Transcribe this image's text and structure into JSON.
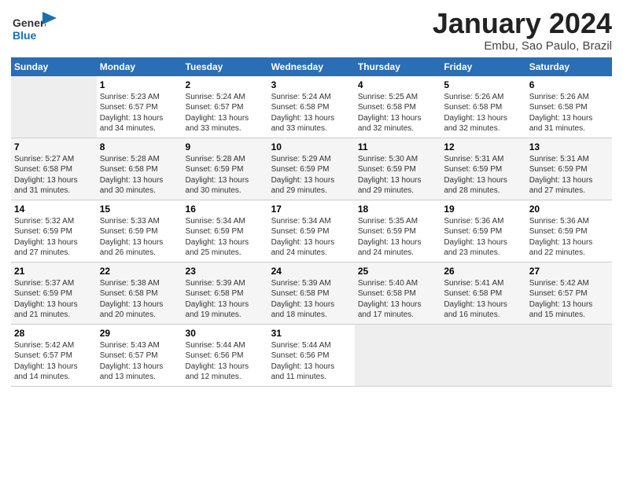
{
  "logo": {
    "general": "General",
    "blue": "Blue"
  },
  "title": {
    "month": "January 2024",
    "location": "Embu, Sao Paulo, Brazil"
  },
  "days_header": [
    "Sunday",
    "Monday",
    "Tuesday",
    "Wednesday",
    "Thursday",
    "Friday",
    "Saturday"
  ],
  "weeks": [
    [
      {
        "num": "",
        "info": ""
      },
      {
        "num": "1",
        "info": "Sunrise: 5:23 AM\nSunset: 6:57 PM\nDaylight: 13 hours\nand 34 minutes."
      },
      {
        "num": "2",
        "info": "Sunrise: 5:24 AM\nSunset: 6:57 PM\nDaylight: 13 hours\nand 33 minutes."
      },
      {
        "num": "3",
        "info": "Sunrise: 5:24 AM\nSunset: 6:58 PM\nDaylight: 13 hours\nand 33 minutes."
      },
      {
        "num": "4",
        "info": "Sunrise: 5:25 AM\nSunset: 6:58 PM\nDaylight: 13 hours\nand 32 minutes."
      },
      {
        "num": "5",
        "info": "Sunrise: 5:26 AM\nSunset: 6:58 PM\nDaylight: 13 hours\nand 32 minutes."
      },
      {
        "num": "6",
        "info": "Sunrise: 5:26 AM\nSunset: 6:58 PM\nDaylight: 13 hours\nand 31 minutes."
      }
    ],
    [
      {
        "num": "7",
        "info": "Sunrise: 5:27 AM\nSunset: 6:58 PM\nDaylight: 13 hours\nand 31 minutes."
      },
      {
        "num": "8",
        "info": "Sunrise: 5:28 AM\nSunset: 6:58 PM\nDaylight: 13 hours\nand 30 minutes."
      },
      {
        "num": "9",
        "info": "Sunrise: 5:28 AM\nSunset: 6:59 PM\nDaylight: 13 hours\nand 30 minutes."
      },
      {
        "num": "10",
        "info": "Sunrise: 5:29 AM\nSunset: 6:59 PM\nDaylight: 13 hours\nand 29 minutes."
      },
      {
        "num": "11",
        "info": "Sunrise: 5:30 AM\nSunset: 6:59 PM\nDaylight: 13 hours\nand 29 minutes."
      },
      {
        "num": "12",
        "info": "Sunrise: 5:31 AM\nSunset: 6:59 PM\nDaylight: 13 hours\nand 28 minutes."
      },
      {
        "num": "13",
        "info": "Sunrise: 5:31 AM\nSunset: 6:59 PM\nDaylight: 13 hours\nand 27 minutes."
      }
    ],
    [
      {
        "num": "14",
        "info": "Sunrise: 5:32 AM\nSunset: 6:59 PM\nDaylight: 13 hours\nand 27 minutes."
      },
      {
        "num": "15",
        "info": "Sunrise: 5:33 AM\nSunset: 6:59 PM\nDaylight: 13 hours\nand 26 minutes."
      },
      {
        "num": "16",
        "info": "Sunrise: 5:34 AM\nSunset: 6:59 PM\nDaylight: 13 hours\nand 25 minutes."
      },
      {
        "num": "17",
        "info": "Sunrise: 5:34 AM\nSunset: 6:59 PM\nDaylight: 13 hours\nand 24 minutes."
      },
      {
        "num": "18",
        "info": "Sunrise: 5:35 AM\nSunset: 6:59 PM\nDaylight: 13 hours\nand 24 minutes."
      },
      {
        "num": "19",
        "info": "Sunrise: 5:36 AM\nSunset: 6:59 PM\nDaylight: 13 hours\nand 23 minutes."
      },
      {
        "num": "20",
        "info": "Sunrise: 5:36 AM\nSunset: 6:59 PM\nDaylight: 13 hours\nand 22 minutes."
      }
    ],
    [
      {
        "num": "21",
        "info": "Sunrise: 5:37 AM\nSunset: 6:59 PM\nDaylight: 13 hours\nand 21 minutes."
      },
      {
        "num": "22",
        "info": "Sunrise: 5:38 AM\nSunset: 6:58 PM\nDaylight: 13 hours\nand 20 minutes."
      },
      {
        "num": "23",
        "info": "Sunrise: 5:39 AM\nSunset: 6:58 PM\nDaylight: 13 hours\nand 19 minutes."
      },
      {
        "num": "24",
        "info": "Sunrise: 5:39 AM\nSunset: 6:58 PM\nDaylight: 13 hours\nand 18 minutes."
      },
      {
        "num": "25",
        "info": "Sunrise: 5:40 AM\nSunset: 6:58 PM\nDaylight: 13 hours\nand 17 minutes."
      },
      {
        "num": "26",
        "info": "Sunrise: 5:41 AM\nSunset: 6:58 PM\nDaylight: 13 hours\nand 16 minutes."
      },
      {
        "num": "27",
        "info": "Sunrise: 5:42 AM\nSunset: 6:57 PM\nDaylight: 13 hours\nand 15 minutes."
      }
    ],
    [
      {
        "num": "28",
        "info": "Sunrise: 5:42 AM\nSunset: 6:57 PM\nDaylight: 13 hours\nand 14 minutes."
      },
      {
        "num": "29",
        "info": "Sunrise: 5:43 AM\nSunset: 6:57 PM\nDaylight: 13 hours\nand 13 minutes."
      },
      {
        "num": "30",
        "info": "Sunrise: 5:44 AM\nSunset: 6:56 PM\nDaylight: 13 hours\nand 12 minutes."
      },
      {
        "num": "31",
        "info": "Sunrise: 5:44 AM\nSunset: 6:56 PM\nDaylight: 13 hours\nand 11 minutes."
      },
      {
        "num": "",
        "info": ""
      },
      {
        "num": "",
        "info": ""
      },
      {
        "num": "",
        "info": ""
      }
    ]
  ]
}
